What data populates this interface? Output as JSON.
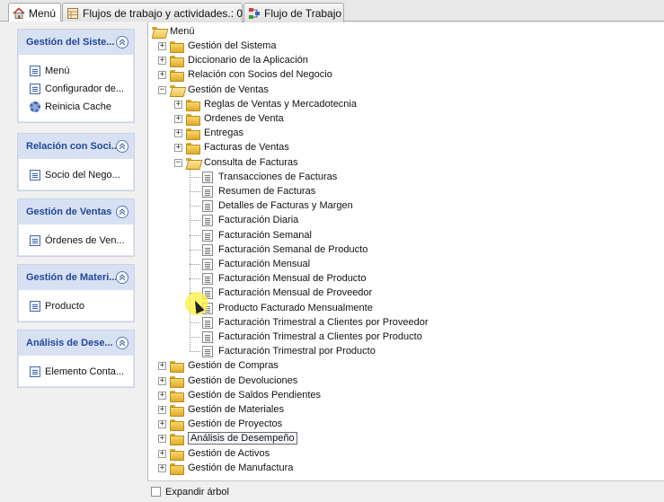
{
  "tabs": [
    {
      "label": "Menú",
      "icon": "home-icon"
    },
    {
      "label": "Flujos de trabajo y actividades.: 0",
      "icon": "workflow-icon"
    },
    {
      "label": "Flujo de Trabajo",
      "icon": "flow-icon"
    }
  ],
  "sidebar": {
    "cards": [
      {
        "title": "Gestión del Siste...",
        "items": [
          {
            "label": "Menú",
            "icon": "document-icon"
          },
          {
            "label": "Configurador de...",
            "icon": "document-icon"
          },
          {
            "label": "Reinicia Cache",
            "icon": "gear-icon"
          }
        ]
      },
      {
        "title": "Relación con Soci...",
        "items": [
          {
            "label": "Socio del Nego...",
            "icon": "document-icon"
          }
        ]
      },
      {
        "title": "Gestión de Ventas",
        "items": [
          {
            "label": "Órdenes de Ven...",
            "icon": "document-icon"
          }
        ]
      },
      {
        "title": "Gestión de Materi...",
        "items": [
          {
            "label": "Producto",
            "icon": "document-icon"
          }
        ]
      },
      {
        "title": "Análisis de Dese...",
        "items": [
          {
            "label": "Elemento Conta...",
            "icon": "document-icon"
          }
        ]
      }
    ]
  },
  "tree": {
    "root": "Menú",
    "nodes": [
      {
        "label": "Gestión del Sistema",
        "level": 1,
        "type": "folder",
        "expanded": false
      },
      {
        "label": "Diccionario de la Aplicación",
        "level": 1,
        "type": "folder",
        "expanded": false
      },
      {
        "label": "Relación con Socios del Negocio",
        "level": 1,
        "type": "folder",
        "expanded": false
      },
      {
        "label": "Gestión de Ventas",
        "level": 1,
        "type": "folder",
        "expanded": true
      },
      {
        "label": "Reglas de Ventas y Mercadotecnia",
        "level": 2,
        "type": "folder",
        "expanded": false
      },
      {
        "label": "Ordenes de Venta",
        "level": 2,
        "type": "folder",
        "expanded": false
      },
      {
        "label": "Entregas",
        "level": 2,
        "type": "folder",
        "expanded": false
      },
      {
        "label": "Facturas de Ventas",
        "level": 2,
        "type": "folder",
        "expanded": false
      },
      {
        "label": "Consulta de Facturas",
        "level": 2,
        "type": "folder",
        "expanded": true
      },
      {
        "label": "Transacciones de Facturas",
        "level": 3,
        "type": "leaf"
      },
      {
        "label": "Resumen de Facturas",
        "level": 3,
        "type": "leaf"
      },
      {
        "label": "Detalles de Facturas y Margen",
        "level": 3,
        "type": "leaf"
      },
      {
        "label": "Facturación Diaria",
        "level": 3,
        "type": "leaf"
      },
      {
        "label": "Facturación Semanal",
        "level": 3,
        "type": "leaf"
      },
      {
        "label": "Facturación Semanal de Producto",
        "level": 3,
        "type": "leaf"
      },
      {
        "label": "Facturación Mensual",
        "level": 3,
        "type": "leaf"
      },
      {
        "label": "Facturación Mensual de Producto",
        "level": 3,
        "type": "leaf"
      },
      {
        "label": "Facturación Mensual de Proveedor",
        "level": 3,
        "type": "leaf"
      },
      {
        "label": "Producto Facturado Mensualmente",
        "level": 3,
        "type": "leaf"
      },
      {
        "label": "Facturación Trimestral a Clientes por Proveedor",
        "level": 3,
        "type": "leaf"
      },
      {
        "label": "Facturación Trimestral a Clientes por Producto",
        "level": 3,
        "type": "leaf"
      },
      {
        "label": "Facturación Trimestral por Producto",
        "level": 3,
        "type": "leaf"
      },
      {
        "label": "Gestión de Compras",
        "level": 1,
        "type": "folder",
        "expanded": false
      },
      {
        "label": "Gestión de Devoluciones",
        "level": 1,
        "type": "folder",
        "expanded": false
      },
      {
        "label": "Gestión de Saldos Pendientes",
        "level": 1,
        "type": "folder",
        "expanded": false
      },
      {
        "label": "Gestión de Materiales",
        "level": 1,
        "type": "folder",
        "expanded": false
      },
      {
        "label": "Gestión de Proyectos",
        "level": 1,
        "type": "folder",
        "expanded": false
      },
      {
        "label": "Análisis de Desempeño",
        "level": 1,
        "type": "folder",
        "expanded": false,
        "selected": true
      },
      {
        "label": "Gestión de Activos",
        "level": 1,
        "type": "folder",
        "expanded": false
      },
      {
        "label": "Gestión de Manufactura",
        "level": 1,
        "type": "folder",
        "expanded": false
      }
    ]
  },
  "footer": {
    "expand_tree_label": "Expandir árbol",
    "expand_tree_checked": false
  },
  "colors": {
    "card_header_text": "#20479a",
    "card_background": "#dfe6f5",
    "folder": "#e0ac2a",
    "cursor_highlight": "#fff03c"
  }
}
